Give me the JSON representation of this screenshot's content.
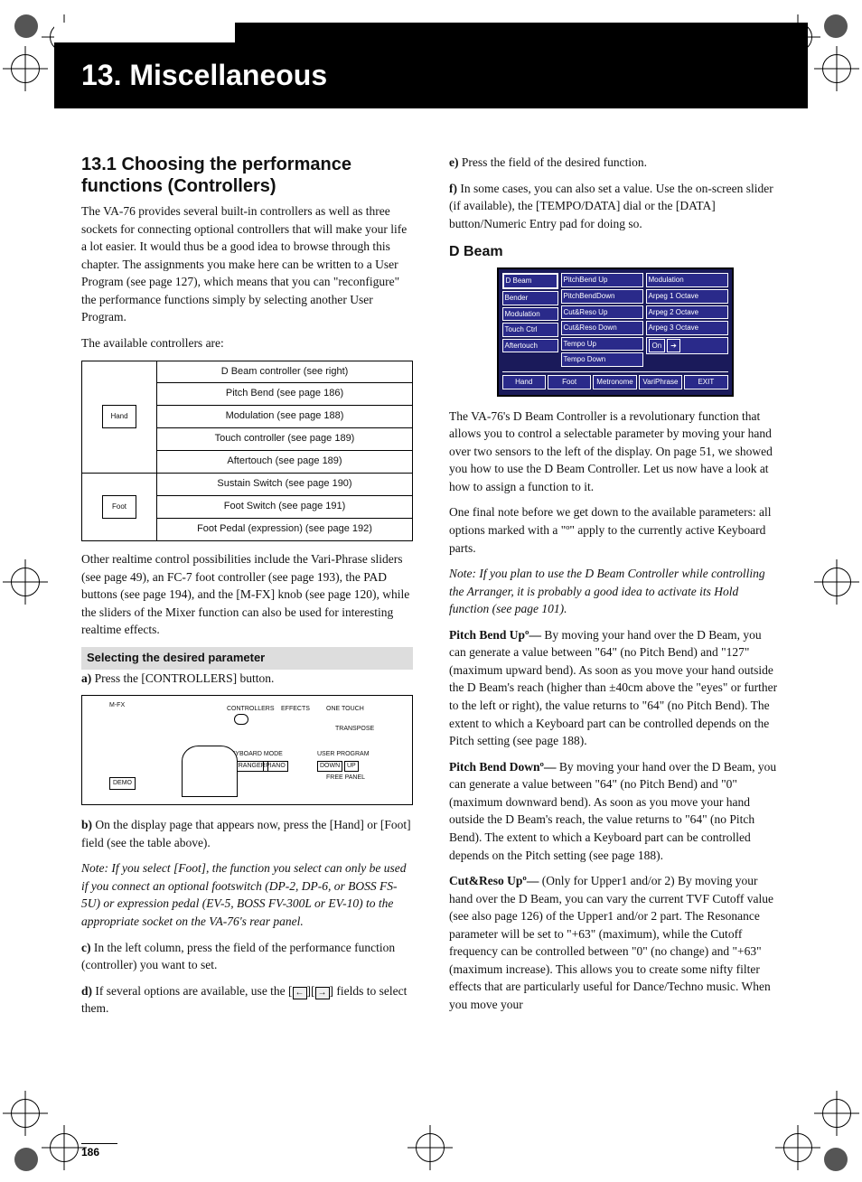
{
  "chapter_title": "13. Miscellaneous",
  "page_number": "186",
  "left": {
    "section_h2": "13.1 Choosing the performance functions (Controllers)",
    "intro": "The VA-76 provides several built-in controllers as well as three sockets for connecting optional controllers that will make your life a lot easier. It would thus be a good idea to browse through this chapter. The assignments you make here can be written to a User Program (see page 127), which means that you can \"reconfigure\" the performance functions simply by selecting another User Program.",
    "avail_line": "The available controllers are:",
    "table": {
      "hand_label": "Hand",
      "foot_label": "Foot",
      "rows_hand": [
        "D Beam controller (see right)",
        "Pitch Bend (see page 186)",
        "Modulation (see page 188)",
        "Touch controller (see page 189)",
        "Aftertouch (see page 189)"
      ],
      "rows_foot": [
        "Sustain Switch (see page 190)",
        "Foot Switch (see page 191)",
        "Foot Pedal (expression) (see page 192)"
      ]
    },
    "after_table": "Other realtime control possibilities include the Vari-Phrase sliders (see page 49), an FC-7 foot controller (see page 193), the PAD buttons (see page 194), and the [M-FX] knob (see page 120), while the sliders of the Mixer function can also be used for interesting realtime effects.",
    "subhead": "Selecting the desired parameter",
    "step_a_b": "a)",
    "step_a": "Press the [CONTROLLERS] button.",
    "panel_labels": {
      "mfx": "M-FX",
      "demo": "DEMO",
      "controllers": "CONTROLLERS",
      "effects": "EFFECTS",
      "one_touch": "ONE TOUCH",
      "transpose": "TRANSPOSE",
      "keyboard_mode": "KEYBOARD MODE",
      "arranger": "ARRANGER",
      "piano": "PIANO",
      "user_program": "USER PROGRAM",
      "down": "DOWN",
      "up": "UP",
      "free_panel": "FREE PANEL"
    },
    "step_b_b": "b)",
    "step_b": "On the display page that appears now, press the [Hand] or [Foot] field (see the table above).",
    "step_b_note": "Note: If you select [Foot], the function you select can only be used if you connect an optional footswitch (DP-2, DP-6, or BOSS FS-5U) or expression pedal (EV-5, BOSS FV-300L or EV-10) to the appropriate socket on the VA-76's rear panel.",
    "step_c_b": "c)",
    "step_c": "In the left column, press the field of the performance function (controller) you want to set.",
    "step_d_b": "d)",
    "step_d_pre": "If several options are available, use the [",
    "step_d_post": "] fields to select them."
  },
  "right": {
    "step_e_b": "e)",
    "step_e": "Press the field of the desired function.",
    "step_f_b": "f)",
    "step_f": "In some cases, you can also set a value. Use the on-screen slider (if available), the [TEMPO/DATA] dial or the [DATA] button/Numeric Entry pad for doing so.",
    "h3": "D Beam",
    "screen": {
      "left_items": [
        "D Beam",
        "Bender",
        "Modulation",
        "Touch Ctrl",
        "Aftertouch"
      ],
      "mid_items": [
        "PitchBend Up",
        "PitchBendDown",
        "Cut&Reso Up",
        "Cut&Reso Down",
        "Tempo Up",
        "Tempo Down"
      ],
      "right_items": [
        "Modulation",
        "Arpeg 1 Octave",
        "Arpeg 2 Octave",
        "Arpeg 3 Octave"
      ],
      "nav_on": "On",
      "nav_arrow": "➔",
      "bottom": [
        "Hand",
        "Foot",
        "Metronome",
        "VariPhrase",
        "EXIT"
      ]
    },
    "p1": "The VA-76's D Beam Controller is a revolutionary function that allows you to control a selectable parameter by moving your hand over two sensors to the left of the display. On page 51, we showed you how to use the D Beam Controller. Let us now have a look at how to assign a function to it.",
    "p2": "One final note before we get down to the available parameters: all options marked with a \"º\" apply to the currently active Keyboard parts.",
    "p2_note": "Note: If you plan to use the D Beam Controller while controlling the Arranger, it is probably a good idea to activate its Hold function (see page 101).",
    "pb_up_b": "Pitch Bend Upº— ",
    "pb_up": "By moving your hand over the D Beam, you can generate a value between \"64\" (no Pitch Bend) and \"127\" (maximum upward bend). As soon as you move your hand outside the D Beam's reach (higher than ±40cm above the \"eyes\" or further to the left or right), the value returns to \"64\" (no Pitch Bend). The extent to which a Keyboard part can be controlled depends on the Pitch setting (see page 188).",
    "pb_dn_b": "Pitch Bend Downº— ",
    "pb_dn": "By moving your hand over the D Beam, you can generate a value between \"64\" (no Pitch Bend) and \"0\" (maximum downward bend). As soon as you move your hand outside the D Beam's reach, the value returns to \"64\" (no Pitch Bend). The extent to which a Keyboard part can be controlled depends on the Pitch setting (see page 188).",
    "cr_b": "Cut&Reso Upº— ",
    "cr": "(Only for Upper1 and/or 2) By moving your hand over the D Beam, you can vary the current TVF Cutoff value (see also page 126) of the Upper1 and/or 2 part. The Resonance parameter will be set to \"+63\" (maximum), while the Cutoff frequency can be controlled between \"0\" (no change) and \"+63\" (maximum increase). This allows you to create some nifty filter effects that are particularly useful for Dance/Techno music. When you move your"
  }
}
